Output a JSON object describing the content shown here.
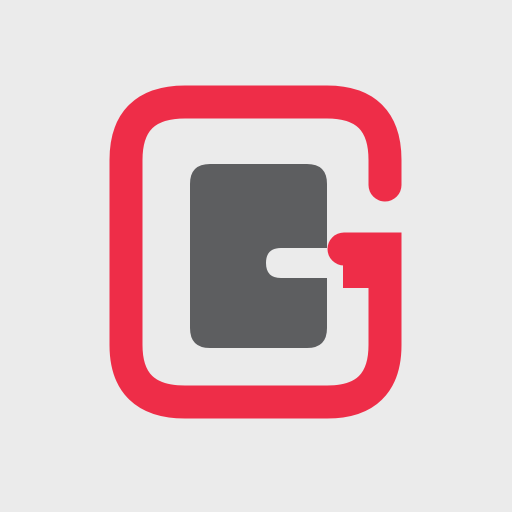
{
  "app_icon": {
    "icon": "wallet-g-logo-icon",
    "colors": {
      "background": "#ebebeb",
      "accent": "#ee2d48",
      "wallet": "#5d5e60"
    }
  }
}
